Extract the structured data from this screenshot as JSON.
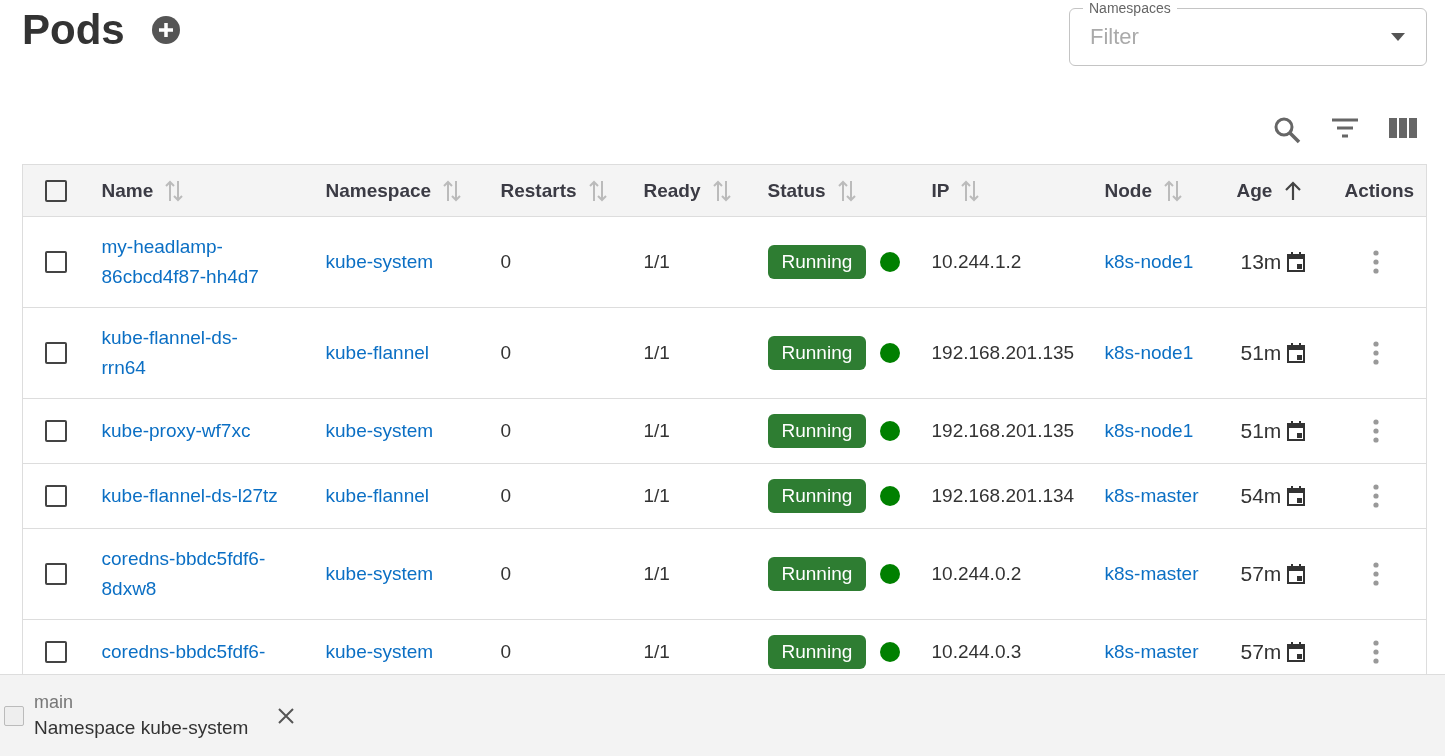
{
  "title": "Pods",
  "namespace_filter": {
    "label": "Namespaces",
    "placeholder": "Filter"
  },
  "table": {
    "select_all": {
      "checked": false
    },
    "columns": [
      {
        "label": "Name",
        "sortable": true,
        "sorted": false
      },
      {
        "label": "Namespace",
        "sortable": true,
        "sorted": false
      },
      {
        "label": "Restarts",
        "sortable": true,
        "sorted": false
      },
      {
        "label": "Ready",
        "sortable": true,
        "sorted": false
      },
      {
        "label": "Status",
        "sortable": true,
        "sorted": false
      },
      {
        "label": "IP",
        "sortable": true,
        "sorted": false
      },
      {
        "label": "Node",
        "sortable": true,
        "sorted": false
      },
      {
        "label": "Age",
        "sortable": true,
        "sorted": true
      },
      {
        "label": "Actions"
      }
    ],
    "rows": [
      {
        "checked": false,
        "name": "my-headlamp-86cbcd4f87-hh4d7",
        "namespace": "kube-system",
        "restarts": "0",
        "ready": "1/1",
        "status": "Running",
        "ip": "10.244.1.2",
        "node": "k8s-node1",
        "age": "13m"
      },
      {
        "checked": false,
        "name": "kube-flannel-ds-rrn64",
        "namespace": "kube-flannel",
        "restarts": "0",
        "ready": "1/1",
        "status": "Running",
        "ip": "192.168.201.135",
        "node": "k8s-node1",
        "age": "51m"
      },
      {
        "checked": false,
        "name": "kube-proxy-wf7xc",
        "namespace": "kube-system",
        "restarts": "0",
        "ready": "1/1",
        "status": "Running",
        "ip": "192.168.201.135",
        "node": "k8s-node1",
        "age": "51m"
      },
      {
        "checked": false,
        "name": "kube-flannel-ds-l27tz",
        "namespace": "kube-flannel",
        "restarts": "0",
        "ready": "1/1",
        "status": "Running",
        "ip": "192.168.201.134",
        "node": "k8s-master",
        "age": "54m"
      },
      {
        "checked": false,
        "name": "coredns-bbdc5fdf6-8dxw8",
        "namespace": "kube-system",
        "restarts": "0",
        "ready": "1/1",
        "status": "Running",
        "ip": "10.244.0.2",
        "node": "k8s-master",
        "age": "57m"
      },
      {
        "checked": false,
        "name": "coredns-bbdc5fdf6-",
        "namespace": "kube-system",
        "restarts": "0",
        "ready": "1/1",
        "status": "Running",
        "ip": "10.244.0.3",
        "node": "k8s-master",
        "age": "57m"
      }
    ]
  },
  "notification": {
    "title": "main",
    "message": "Namespace kube-system"
  }
}
